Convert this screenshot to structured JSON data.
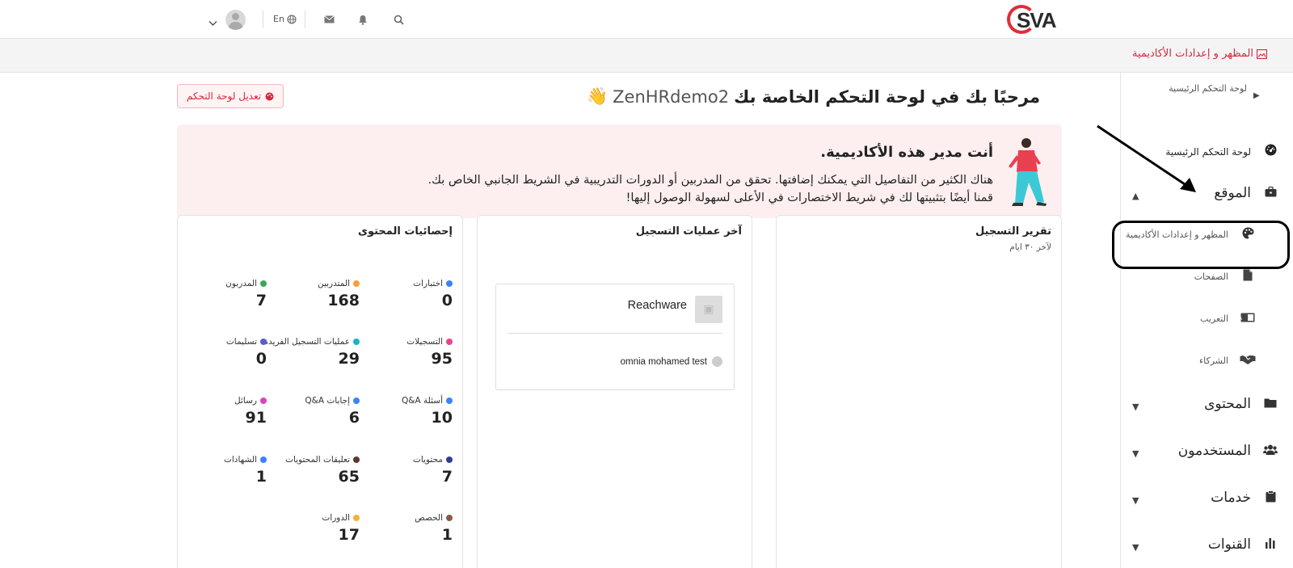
{
  "header": {
    "logo_text": "SVA",
    "language": "En"
  },
  "breadcrumb": {
    "label": "المظهر و إعدادات الأكاديمية"
  },
  "welcome": {
    "text": "مرحبًا بك في لوحة التحكم الخاصة بك",
    "username": "ZenHRdemo2",
    "emoji": "👋",
    "edit_button": "تعديل لوحة التحكم"
  },
  "alert": {
    "title": "أنت مدير هذه الأكاديمية.",
    "line1": "هناك الكثير من التفاصيل التي يمكنك إضافتها. تحقق من المدربين أو الدورات التدريبية في الشريط الجانبي الخاص بك.",
    "line2": "قمنا أيضًا بتثبيتها لك في شريط الاختصارات في الأعلى لسهولة الوصول إليها!"
  },
  "sidebar": {
    "items": [
      {
        "label": "لوحة التحكم الرئيسية",
        "icon": "dashboard-icon"
      },
      {
        "label": "لوحة التحكم الرئيسية",
        "icon": "gauge-icon"
      },
      {
        "label": "الموقع",
        "icon": "briefcase-icon"
      },
      {
        "label": "المظهر و إعدادات الأكاديمية",
        "icon": "palette-icon"
      },
      {
        "label": "الصفحات",
        "icon": "file-icon"
      },
      {
        "label": "التعريب",
        "icon": "language-icon"
      },
      {
        "label": "الشركاء",
        "icon": "handshake-icon"
      },
      {
        "label": "المحتوى",
        "icon": "folder-icon"
      },
      {
        "label": "المستخدمون",
        "icon": "users-icon"
      },
      {
        "label": "خدمات",
        "icon": "clipboard-icon"
      },
      {
        "label": "القنوات",
        "icon": "chart-icon"
      }
    ]
  },
  "cards": {
    "registration_report": {
      "title": "تقرير التسجيل",
      "subtitle": "لآخر ٣٠ ايام"
    },
    "latest_registrations": {
      "title": "آخر عمليات التسجيل",
      "course": "Reachware",
      "user": "omnia mohamed test"
    },
    "content_stats": {
      "title": "إحصائيات المحتوى",
      "stats": [
        {
          "label": "اختبارات",
          "value": "0",
          "color": "#3b82f6"
        },
        {
          "label": "المتدربين",
          "value": "168",
          "color": "#f59e3b"
        },
        {
          "label": "المدربون",
          "value": "7",
          "color": "#3aa757"
        },
        {
          "label": "التسجيلات",
          "value": "95",
          "color": "#e84393"
        },
        {
          "label": "عمليات التسجيل الفريدة",
          "value": "29",
          "color": "#17b5c9"
        },
        {
          "label": "تسليمات",
          "value": "0",
          "color": "#5b5bd6"
        },
        {
          "label": "أسئلة Q&A",
          "value": "10",
          "color": "#3b82f6"
        },
        {
          "label": "إجابات Q&A",
          "value": "6",
          "color": "#3b82f6"
        },
        {
          "label": "رسائل",
          "value": "91",
          "color": "#d946b8"
        },
        {
          "label": "محتويات",
          "value": "7",
          "color": "#2e3f8f"
        },
        {
          "label": "تعليقات المحتويات",
          "value": "65",
          "color": "#5a3a2e"
        },
        {
          "label": "الشهادات",
          "value": "1",
          "color": "#3b82f6"
        },
        {
          "label": "الحصص",
          "value": "1",
          "color": "#8a5a44"
        },
        {
          "label": "الدورات",
          "value": "17",
          "color": "#f5b03b"
        }
      ]
    }
  }
}
